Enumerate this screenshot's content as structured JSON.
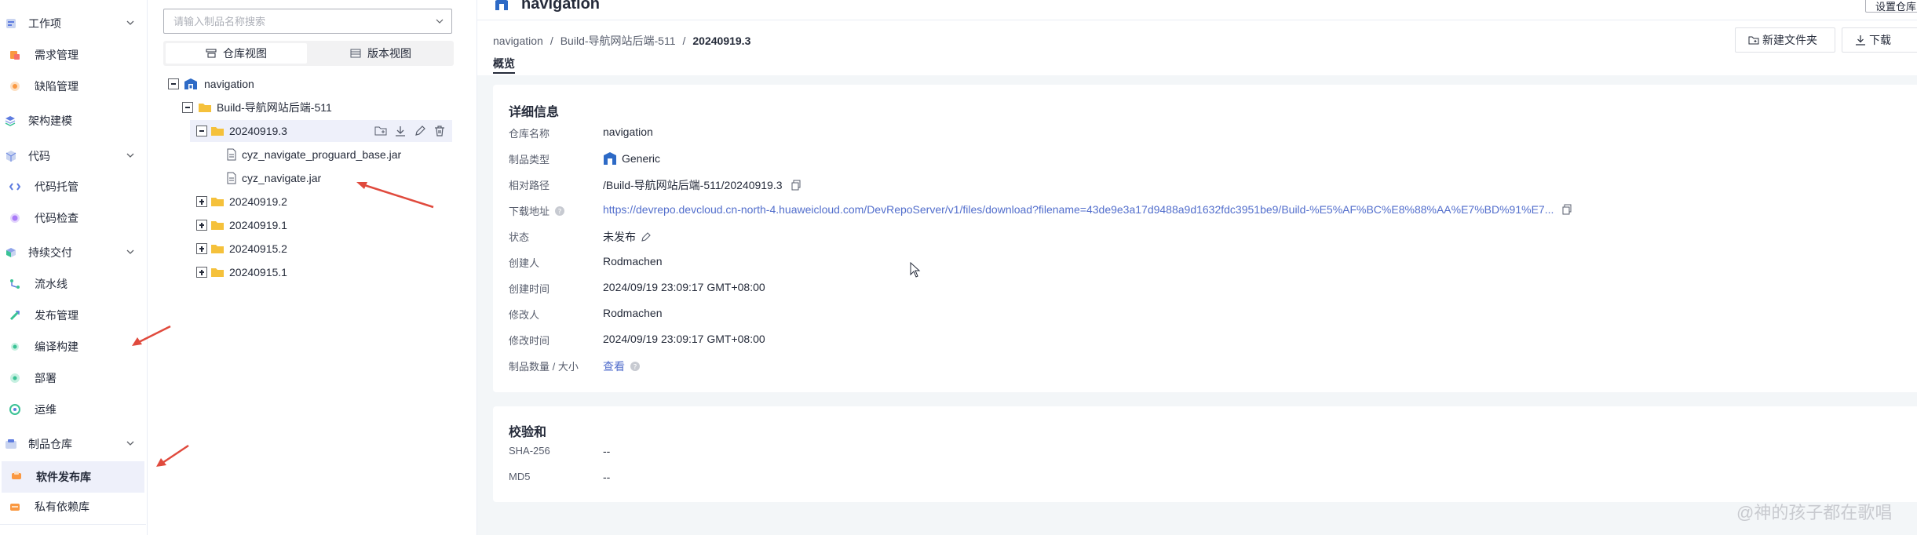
{
  "sidebar": {
    "groups": [
      {
        "label": "工作项",
        "icon": "workitem-icon"
      },
      {
        "label": "代码",
        "icon": "code-icon"
      },
      {
        "label": "持续交付",
        "icon": "delivery-icon"
      },
      {
        "label": "制品仓库",
        "icon": "artifact-icon"
      }
    ],
    "items": [
      {
        "label": "需求管理",
        "icon": "requirement-icon",
        "color": "#f66f6a"
      },
      {
        "label": "缺陷管理",
        "icon": "bug-icon",
        "color": "#fa9841"
      },
      {
        "label": "架构建模",
        "icon": "architecture-icon",
        "color": "#5e7ce0"
      },
      {
        "label": "代码托管",
        "icon": "repo-icon",
        "color": "#5e7ce0"
      },
      {
        "label": "代码检查",
        "icon": "codecheck-icon",
        "color": "#a97af8"
      },
      {
        "label": "流水线",
        "icon": "pipeline-icon",
        "color": "#3ac295"
      },
      {
        "label": "发布管理",
        "icon": "release-icon",
        "color": "#3ac295"
      },
      {
        "label": "编译构建",
        "icon": "build-icon",
        "color": "#3ac295"
      },
      {
        "label": "部署",
        "icon": "deploy-icon",
        "color": "#3ac295"
      },
      {
        "label": "运维",
        "icon": "ops-icon",
        "color": "#3ac295"
      },
      {
        "label": "软件发布库",
        "icon": "software-repo-icon",
        "color": "#fa9841"
      },
      {
        "label": "私有依赖库",
        "icon": "private-repo-icon",
        "color": "#fa9841"
      }
    ]
  },
  "tree": {
    "search_placeholder": "请输入制品名称搜索",
    "tabs": [
      "仓库视图",
      "版本视图"
    ],
    "root": "navigation",
    "build": "Build-导航网站后端-511",
    "selected_version": "20240919.3",
    "files": [
      "cyz_navigate_proguard_base.jar",
      "cyz_navigate.jar"
    ],
    "versions": [
      "20240919.2",
      "20240919.1",
      "20240915.2",
      "20240915.1"
    ]
  },
  "header": {
    "title": "navigation",
    "settings_label": "设置仓库",
    "breadcrumb": [
      "navigation",
      "Build-导航网站后端-511",
      "20240919.3"
    ],
    "new_folder_label": "新建文件夹",
    "download_label": "下载",
    "tab_label": "概览"
  },
  "details": {
    "title": "详细信息",
    "rows": [
      {
        "label": "仓库名称",
        "value": "navigation"
      },
      {
        "label": "制品类型",
        "value": "Generic"
      },
      {
        "label": "相对路径",
        "value": "/Build-导航网站后端-511/20240919.3"
      },
      {
        "label": "下载地址",
        "value": "https://devrepo.devcloud.cn-north-4.huaweicloud.com/DevRepoServer/v1/files/download?filename=43de9e3a17d9488a9d1632fdc3951be9/Build-%E5%AF%BC%E8%88%AA%E7%BD%91%E7..."
      },
      {
        "label": "状态",
        "value": "未发布"
      },
      {
        "label": "创建人",
        "value": "Rodmachen"
      },
      {
        "label": "创建时间",
        "value": "2024/09/19 23:09:17 GMT+08:00"
      },
      {
        "label": "修改人",
        "value": "Rodmachen"
      },
      {
        "label": "修改时间",
        "value": "2024/09/19 23:09:17 GMT+08:00"
      },
      {
        "label": "制品数量 / 大小",
        "value": "查看"
      }
    ]
  },
  "checksum": {
    "title": "校验和",
    "rows": [
      {
        "label": "SHA-256",
        "value": "--"
      },
      {
        "label": "MD5",
        "value": "--"
      }
    ]
  },
  "watermark": "@神的孩子都在歌唱",
  "colors": {
    "accent": "#526ecc",
    "annotation": "#e04a3d",
    "folder": "#f5c13b"
  }
}
